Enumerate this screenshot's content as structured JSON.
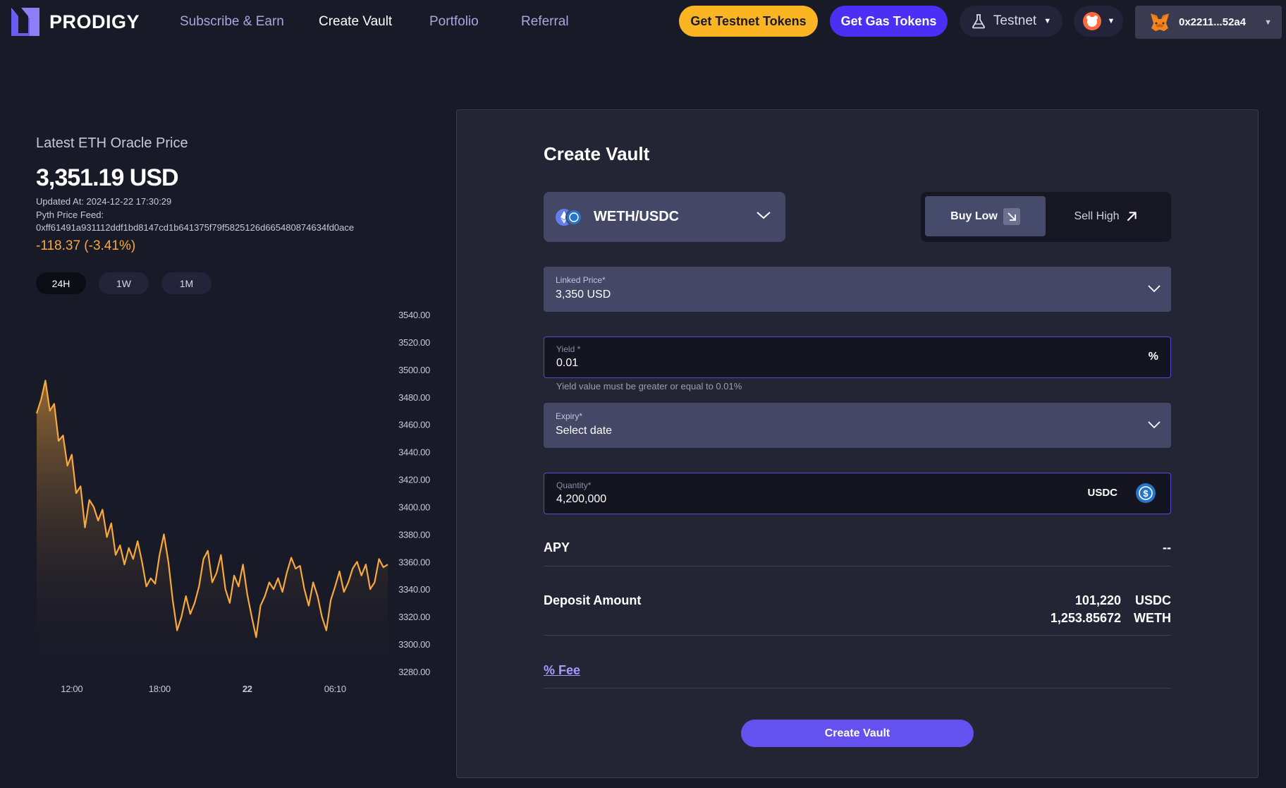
{
  "header": {
    "brand": "PRODIGY",
    "nav": [
      {
        "label": "Subscribe & Earn",
        "active": false
      },
      {
        "label": "Create Vault",
        "active": true
      },
      {
        "label": "Portfolio",
        "active": false
      },
      {
        "label": "Referral",
        "active": false
      }
    ],
    "testnet_tokens_label": "Get Testnet Tokens",
    "gas_tokens_label": "Get Gas Tokens",
    "network_label": "Testnet",
    "wallet_address": "0x2211...52a4",
    "colors": {
      "testnet_button": "#fbb523",
      "gas_button": "#4b2ff5"
    }
  },
  "oracle": {
    "title": "Latest ETH Oracle Price",
    "price": "3,351.19 USD",
    "updated_at": "Updated At: 2024-12-22 17:30:29",
    "feed_label": "Pyth Price Feed:",
    "feed_id": "0xff61491a931112ddf1bd8147cd1b641375f79f5825126d665480874634fd0ace",
    "change": "-118.37 (-3.41%)",
    "change_color": "#f7a93c",
    "ranges": [
      {
        "label": "24H",
        "active": true
      },
      {
        "label": "1W",
        "active": false
      },
      {
        "label": "1M",
        "active": false
      }
    ]
  },
  "chart_data": {
    "type": "area",
    "title": "",
    "xlabel": "",
    "ylabel": "",
    "ylim": [
      3280,
      3540
    ],
    "y_ticks": [
      "3540.00",
      "3520.00",
      "3500.00",
      "3480.00",
      "3460.00",
      "3440.00",
      "3420.00",
      "3400.00",
      "3380.00",
      "3360.00",
      "3340.00",
      "3320.00",
      "3300.00",
      "3280.00"
    ],
    "x_ticks": [
      {
        "label": "12:00",
        "index": 8
      },
      {
        "label": "18:00",
        "index": 28
      },
      {
        "label": "22",
        "index": 48
      },
      {
        "label": "06:10",
        "index": 68
      }
    ],
    "line_color": "#f7a93c",
    "grid": false,
    "series": [
      {
        "values": [
          3468,
          3478,
          3492,
          3470,
          3475,
          3448,
          3452,
          3430,
          3438,
          3410,
          3415,
          3385,
          3405,
          3400,
          3390,
          3398,
          3378,
          3388,
          3365,
          3372,
          3358,
          3370,
          3362,
          3375,
          3360,
          3342,
          3348,
          3344,
          3365,
          3380,
          3360,
          3332,
          3310,
          3320,
          3335,
          3322,
          3330,
          3342,
          3362,
          3368,
          3345,
          3352,
          3365,
          3340,
          3330,
          3350,
          3342,
          3358,
          3336,
          3320,
          3305,
          3328,
          3335,
          3345,
          3340,
          3348,
          3338,
          3352,
          3363,
          3355,
          3357,
          3340,
          3328,
          3345,
          3335,
          3320,
          3310,
          3332,
          3342,
          3353,
          3338,
          3345,
          3355,
          3360,
          3350,
          3358,
          3340,
          3345,
          3362,
          3356,
          3358
        ]
      }
    ]
  },
  "vault": {
    "title": "Create Vault",
    "pair": "WETH/USDC",
    "buy_low": "Buy Low",
    "sell_high": "Sell High",
    "linked_price_label": "Linked Price*",
    "linked_price_value": "3,350 USD",
    "yield_label": "Yield *",
    "yield_value": "0.01",
    "yield_suffix": "%",
    "yield_helper": "Yield value must be greater or equal to 0.01%",
    "expiry_label": "Expiry*",
    "expiry_value": "Select date",
    "quantity_label": "Quantity*",
    "quantity_value": "4,200,000",
    "quantity_unit": "USDC",
    "apy_label": "APY",
    "apy_value": "--",
    "deposit_label": "Deposit Amount",
    "deposit_usdc": "101,220",
    "deposit_usdc_unit": "USDC",
    "deposit_weth": "1,253.85672",
    "deposit_weth_unit": "WETH",
    "fee_label": "% Fee",
    "submit_label": "Create Vault"
  }
}
